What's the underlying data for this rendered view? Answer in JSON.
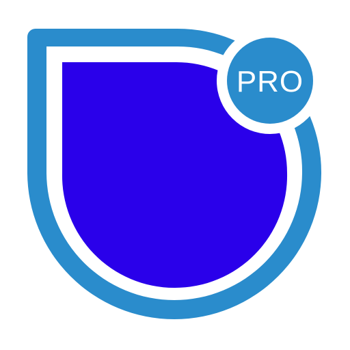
{
  "icon": {
    "name": "shield-icon",
    "badge_text": "PRO"
  },
  "colors": {
    "background": "#ffffff",
    "shield_outline": "#2a8ccc",
    "shield_inner_gap": "#ffffff",
    "shield_fill": "#2a00ea",
    "badge_fill": "#2a8ccc",
    "badge_ring": "#ffffff",
    "badge_text": "#ffffff"
  }
}
